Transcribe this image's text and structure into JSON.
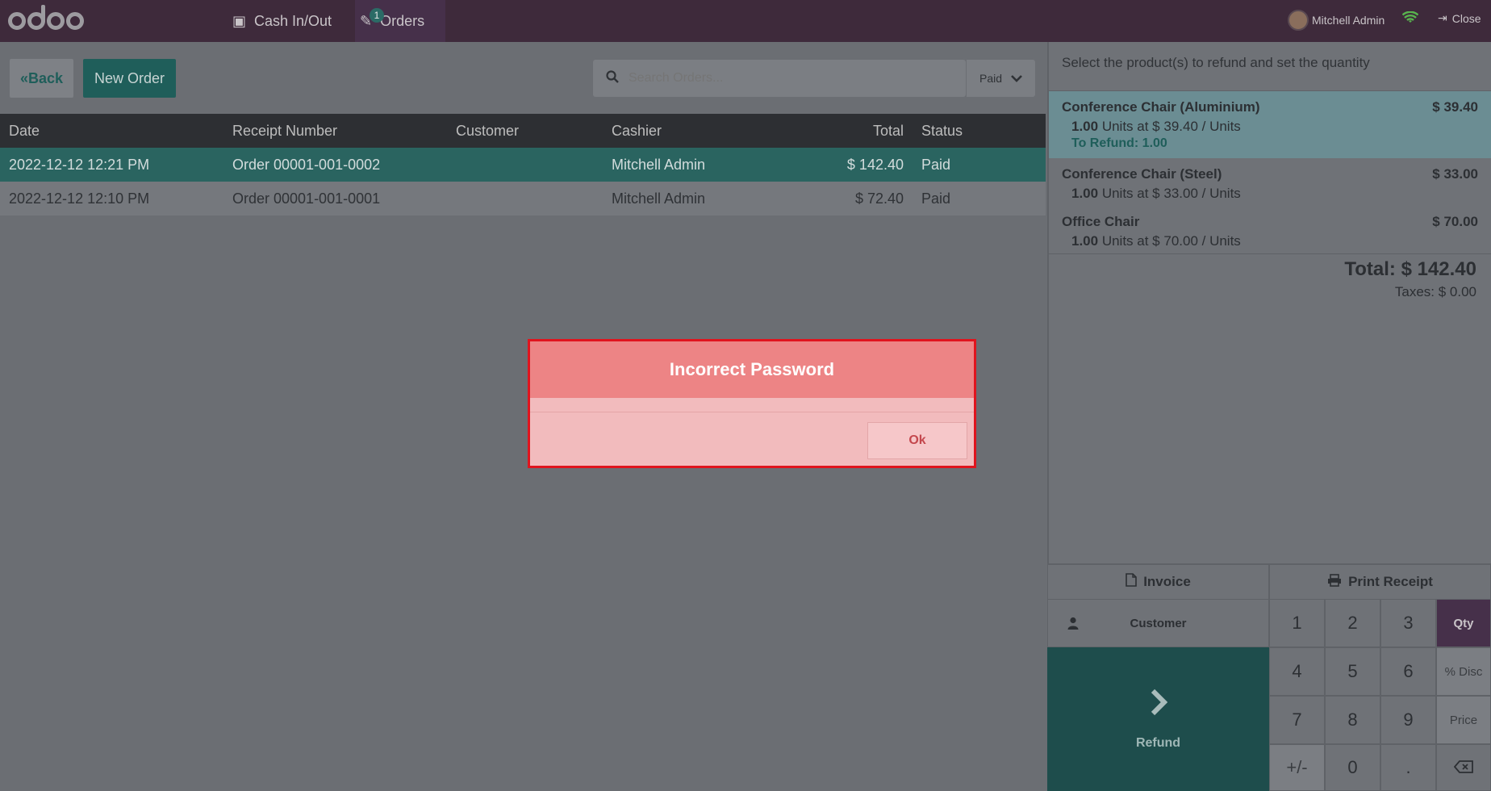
{
  "topbar": {
    "logo_text": "odoo",
    "nav": {
      "cash_label": "Cash In/Out",
      "orders_label": "Orders",
      "orders_badge": "1"
    },
    "user_name": "Mitchell Admin",
    "close_label": "Close",
    "status_color": "#58b44e"
  },
  "controls": {
    "back_label": "Back",
    "new_order_label": "New Order",
    "search_placeholder": "Search Orders...",
    "filter_value": "Paid"
  },
  "table": {
    "headers": [
      "Date",
      "Receipt Number",
      "Customer",
      "Cashier",
      "Total",
      "Status"
    ],
    "rows": [
      {
        "date": "2022-12-12 12:21 PM",
        "receipt": "Order 00001-001-0002",
        "customer": "",
        "cashier": "Mitchell Admin",
        "total": "$ 142.40",
        "status": "Paid"
      },
      {
        "date": "2022-12-12 12:10 PM",
        "receipt": "Order 00001-001-0001",
        "customer": "",
        "cashier": "Mitchell Admin",
        "total": "$ 72.40",
        "status": "Paid"
      }
    ]
  },
  "refund_panel": {
    "hint": "Select the product(s) to refund and set the quantity",
    "lines": [
      {
        "name": "Conference Chair (Aluminium)",
        "price": "$ 39.40",
        "qty": "1.00",
        "detail": "Units at $ 39.40 / Units",
        "to_refund": "To Refund: 1.00"
      },
      {
        "name": "Conference Chair (Steel)",
        "price": "$ 33.00",
        "qty": "1.00",
        "detail": "Units at $ 33.00 / Units"
      },
      {
        "name": "Office Chair",
        "price": "$ 70.00",
        "qty": "1.00",
        "detail": "Units at $ 70.00 / Units"
      }
    ],
    "total": "Total: $ 142.40",
    "taxes": "Taxes: $ 0.00"
  },
  "pad": {
    "invoice_label": "Invoice",
    "print_label": "Print Receipt",
    "customer_label": "Customer",
    "refund_label": "Refund",
    "keys": [
      "1",
      "2",
      "3",
      "Qty",
      "4",
      "5",
      "6",
      "% Disc",
      "7",
      "8",
      "9",
      "Price",
      "+/-",
      "0",
      "."
    ]
  },
  "modal": {
    "title": "Incorrect Password",
    "ok_label": "Ok",
    "border_color": "#e0141e"
  }
}
